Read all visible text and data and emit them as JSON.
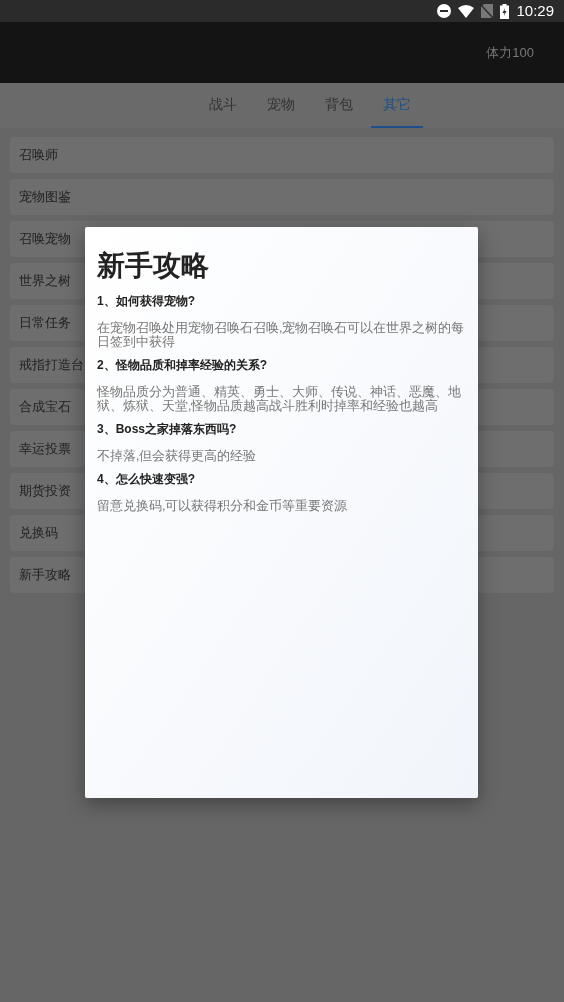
{
  "status_bar": {
    "time": "10:29"
  },
  "header": {
    "stamina": "体力100"
  },
  "tabs": [
    {
      "label": "战斗",
      "selected": false
    },
    {
      "label": "宠物",
      "selected": false
    },
    {
      "label": "背包",
      "selected": false
    },
    {
      "label": "其它",
      "selected": true
    }
  ],
  "menu_items": [
    "召唤师",
    "宠物图鉴",
    "召唤宠物",
    "世界之树",
    "日常任务",
    "戒指打造台",
    "合成宝石",
    "幸运投票",
    "期货投资",
    "兑换码",
    "新手攻略"
  ],
  "dialog": {
    "title": "新手攻略",
    "sections": [
      {
        "question": "1、如何获得宠物?",
        "answer": "在宠物召唤处用宠物召唤石召唤,宠物召唤石可以在世界之树的每日签到中获得"
      },
      {
        "question": "2、怪物品质和掉率经验的关系?",
        "answer": "怪物品质分为普通、精英、勇士、大师、传说、神话、恶魔、地狱、炼狱、天堂,怪物品质越高战斗胜利时掉率和经验也越高"
      },
      {
        "question": "3、Boss之家掉落东西吗?",
        "answer": "不掉落,但会获得更高的经验"
      },
      {
        "question": "4、怎么快速变强?",
        "answer": "留意兑换码,可以获得积分和金币等重要资源"
      }
    ]
  }
}
